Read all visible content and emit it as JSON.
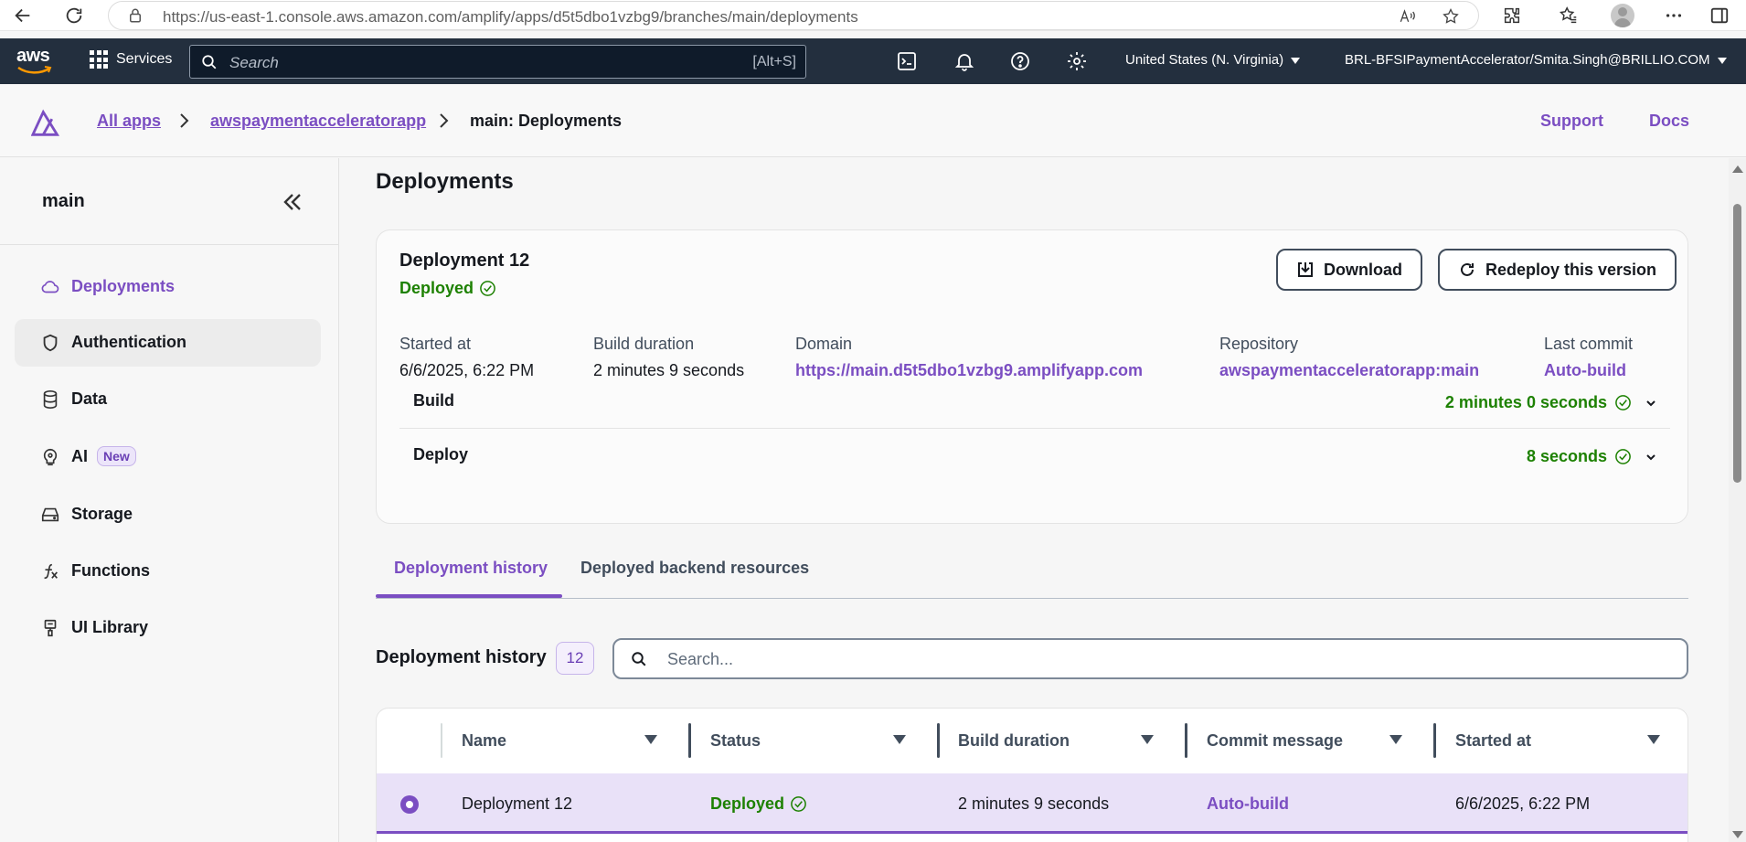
{
  "browser": {
    "url": "https://us-east-1.console.aws.amazon.com/amplify/apps/d5t5dbo1vzbg9/branches/main/deployments"
  },
  "awsnav": {
    "logo_text": "aws",
    "services_label": "Services",
    "search_placeholder": "Search",
    "search_shortcut": "[Alt+S]",
    "region": "United States (N. Virginia)",
    "account": "BRL-BFSIPaymentAccelerator/Smita.Singh@BRILLIO.COM"
  },
  "header": {
    "crumbs": [
      "All apps",
      "awspaymentacceleratorapp",
      "main: Deployments"
    ],
    "support_label": "Support",
    "docs_label": "Docs"
  },
  "sidebar": {
    "title": "main",
    "items": [
      {
        "label": "Deployments",
        "icon": "cloud-icon"
      },
      {
        "label": "Authentication",
        "icon": "shield-icon"
      },
      {
        "label": "Data",
        "icon": "database-icon"
      },
      {
        "label": "AI",
        "icon": "brain-icon",
        "badge": "New"
      },
      {
        "label": "Storage",
        "icon": "storage-icon"
      },
      {
        "label": "Functions",
        "icon": "function-icon"
      },
      {
        "label": "UI Library",
        "icon": "paint-icon"
      }
    ]
  },
  "page": {
    "title": "Deployments"
  },
  "deployment": {
    "name": "Deployment 12",
    "status": "Deployed",
    "download_label": "Download",
    "redeploy_label": "Redeploy this version",
    "started_at_label": "Started at",
    "started_at": "6/6/2025, 6:22 PM",
    "build_duration_label": "Build duration",
    "build_duration": "2 minutes 9 seconds",
    "domain_label": "Domain",
    "domain": "https://main.d5t5dbo1vzbg9.amplifyapp.com",
    "repository_label": "Repository",
    "repository": "awspaymentacceleratorapp:main",
    "last_commit_label": "Last commit",
    "last_commit": "Auto-build",
    "phases": [
      {
        "name": "Build",
        "time": "2 minutes 0 seconds"
      },
      {
        "name": "Deploy",
        "time": "8 seconds"
      }
    ]
  },
  "tabs": [
    "Deployment history",
    "Deployed backend resources"
  ],
  "history": {
    "title": "Deployment history",
    "count": "12",
    "search_placeholder": "Search...",
    "columns": [
      "Name",
      "Status",
      "Build duration",
      "Commit message",
      "Started at"
    ],
    "rows": [
      {
        "name": "Deployment 12",
        "status": "Deployed",
        "build_duration": "2 minutes 9 seconds",
        "commit_message": "Auto-build",
        "started_at": "6/6/2025, 6:22 PM"
      }
    ]
  },
  "colors": {
    "accent": "#7b4ec2",
    "success": "#1d8102",
    "aws_nav": "#232f3e"
  }
}
